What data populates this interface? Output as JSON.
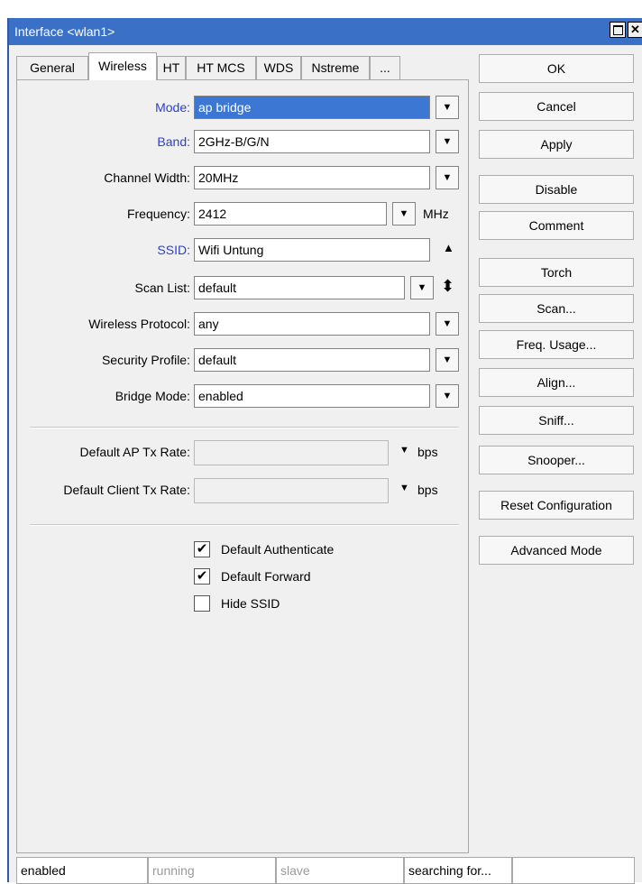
{
  "window": {
    "title": "Interface <wlan1>",
    "maximize_glyph": "",
    "close_glyph": "✕"
  },
  "tabs": [
    {
      "label": "General",
      "active": false
    },
    {
      "label": "Wireless",
      "active": true
    },
    {
      "label": "HT",
      "active": false
    },
    {
      "label": "HT MCS",
      "active": false
    },
    {
      "label": "WDS",
      "active": false
    },
    {
      "label": "Nstreme",
      "active": false
    },
    {
      "label": "...",
      "active": false
    }
  ],
  "form": {
    "mode": {
      "label": "Mode:",
      "value": "ap bridge"
    },
    "band": {
      "label": "Band:",
      "value": "2GHz-B/G/N"
    },
    "channel_width": {
      "label": "Channel Width:",
      "value": "20MHz"
    },
    "frequency": {
      "label": "Frequency:",
      "value": "2412",
      "unit": "MHz"
    },
    "ssid": {
      "label": "SSID:",
      "value": "Wifi Untung"
    },
    "scan_list": {
      "label": "Scan List:",
      "value": "default"
    },
    "wireless_protocol": {
      "label": "Wireless Protocol:",
      "value": "any"
    },
    "security_profile": {
      "label": "Security Profile:",
      "value": "default"
    },
    "bridge_mode": {
      "label": "Bridge Mode:",
      "value": "enabled"
    },
    "default_ap_tx_rate": {
      "label": "Default AP Tx Rate:",
      "value": "",
      "unit": "bps"
    },
    "default_client_tx_rate": {
      "label": "Default Client Tx Rate:",
      "value": "",
      "unit": "bps"
    },
    "checkboxes": [
      {
        "label": "Default Authenticate",
        "checked": true
      },
      {
        "label": "Default Forward",
        "checked": true
      },
      {
        "label": "Hide SSID",
        "checked": false
      }
    ]
  },
  "icons": {
    "dropdown": "▼",
    "up_arrow": "▲",
    "up_down": "⬍",
    "check": "✔"
  },
  "buttons": {
    "ok": "OK",
    "cancel": "Cancel",
    "apply": "Apply",
    "disable": "Disable",
    "comment": "Comment",
    "torch": "Torch",
    "scan": "Scan...",
    "freq_usage": "Freq. Usage...",
    "align": "Align...",
    "sniff": "Sniff...",
    "snooper": "Snooper...",
    "reset_configuration": "Reset Configuration",
    "advanced_mode": "Advanced Mode"
  },
  "status": {
    "enabled": "enabled",
    "running": "running",
    "slave": "slave",
    "searching": "searching for..."
  },
  "colors": {
    "titlebar": "#3a70c6",
    "label_blue": "#2b3fcf",
    "selection": "#3c77d4"
  }
}
